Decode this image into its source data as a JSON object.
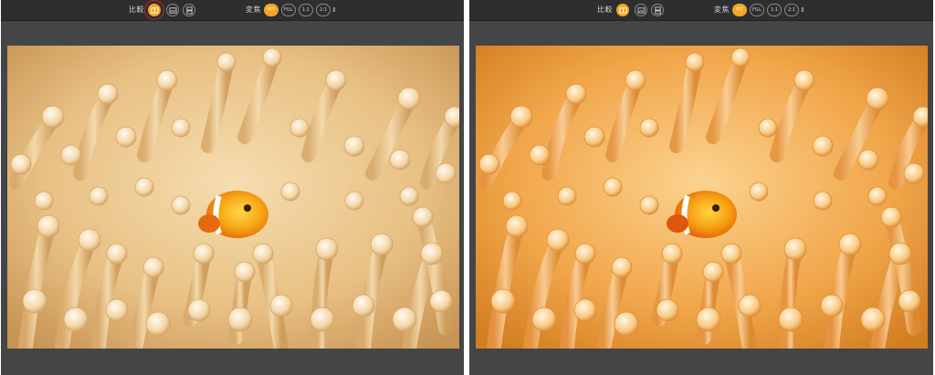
{
  "panels": [
    {
      "compare_label": "比較",
      "zoom_label": "変焦",
      "zoom_options": [
        "FIT",
        "FILL",
        "1:1",
        "2:1"
      ],
      "selected_zoom": "FIT",
      "view_modes": [
        "side-by-side-icon",
        "split-image-icon",
        "stacked-icon"
      ],
      "active_view_mode": 0,
      "highlighted": true
    },
    {
      "compare_label": "比較",
      "zoom_label": "変焦",
      "zoom_options": [
        "FIT",
        "FILL",
        "1:1",
        "2:1"
      ],
      "selected_zoom": "FIT",
      "view_modes": [
        "side-by-side-icon",
        "split-image-icon",
        "stacked-icon"
      ],
      "active_view_mode": 0,
      "highlighted": false
    }
  ],
  "colors": {
    "accent": "#f2a623",
    "highlight_ring": "#d01f24",
    "toolbar_bg": "#2d2e30",
    "panel_bg": "#444546",
    "photo_left_tint": "#f1d3a1",
    "photo_right_tint": "#f7c277"
  }
}
